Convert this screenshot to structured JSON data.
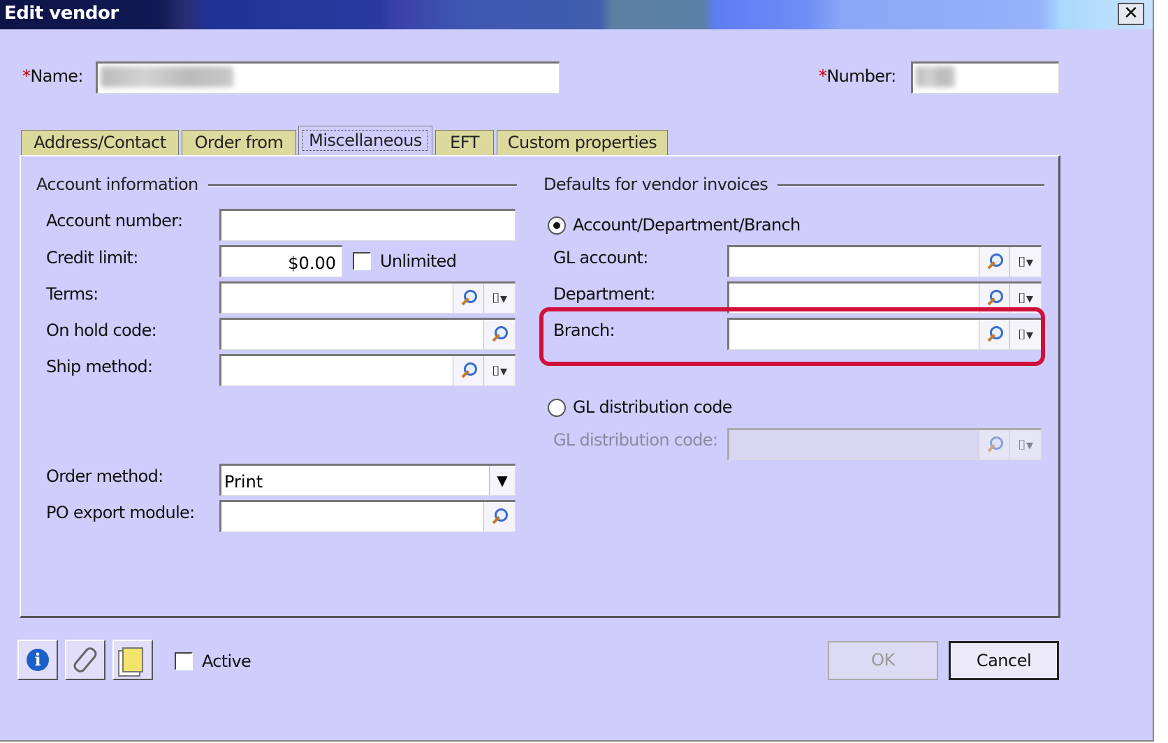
{
  "window": {
    "title": "Edit vendor",
    "close_glyph": "✕"
  },
  "header": {
    "name_label": "Name:",
    "number_label": "Number:",
    "required_mark": "*",
    "name_value": "",
    "number_value": ""
  },
  "tabs": [
    {
      "label": "Address/Contact"
    },
    {
      "label": "Order from"
    },
    {
      "label": "Miscellaneous"
    },
    {
      "label": "EFT"
    },
    {
      "label": "Custom properties"
    }
  ],
  "account": {
    "group_title": "Account information",
    "account_number_label": "Account number:",
    "credit_limit_label": "Credit limit:",
    "credit_limit_value": "$0.00",
    "unlimited_label": "Unlimited",
    "terms_label": "Terms:",
    "on_hold_label": "On hold code:",
    "ship_method_label": "Ship method:",
    "order_method_label": "Order method:",
    "order_method_value": "Print",
    "po_export_label": "PO export module:"
  },
  "defaults": {
    "group_title": "Defaults for vendor invoices",
    "radio_adb_label": "Account/Department/Branch",
    "gl_account_label": "GL account:",
    "department_label": "Department:",
    "branch_label": "Branch:",
    "radio_gl_label": "GL distribution code",
    "gl_dist_label": "GL distribution code:"
  },
  "footer": {
    "active_label": "Active",
    "ok_label": "OK",
    "cancel_label": "Cancel"
  },
  "colors": {
    "dialog_bg": "#cfcdfb",
    "tab_bg": "#dcd99c",
    "highlight": "#d0103a"
  },
  "icons": [
    "close-icon",
    "search-icon",
    "dropdown-menu-icon",
    "info-icon",
    "paperclip-icon",
    "notes-icon",
    "chevron-down-icon"
  ]
}
